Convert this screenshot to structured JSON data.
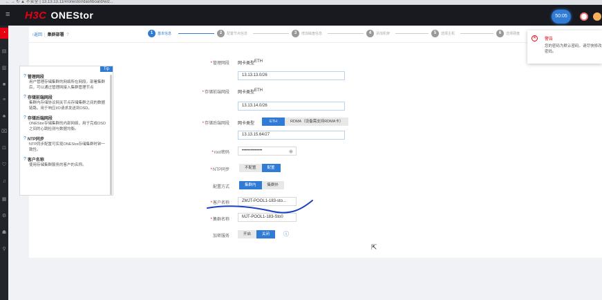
{
  "browser": {
    "url": "← → ↻  ▲ 不安全 | 13.13.13.11/#/onestor/dashboard/wiz..."
  },
  "app": {
    "brand_h3c": "H3C",
    "brand_name": "ONEStor",
    "timer": "50:05"
  },
  "breadcrumb": {
    "back": "↑返回",
    "current": "集群部署",
    "help": "?"
  },
  "steps": [
    {
      "num": "1",
      "label": "基本信息"
    },
    {
      "num": "2",
      "label": "配置节点信息"
    },
    {
      "num": "3",
      "label": "增加磁盘信息"
    },
    {
      "num": "4",
      "label": "添加机架"
    },
    {
      "num": "5",
      "label": "选择主机"
    },
    {
      "num": "6",
      "label": "选择硬盘"
    }
  ],
  "tip": {
    "badge": "Tip",
    "items": [
      {
        "title": "管理网段",
        "desc": "用户管理存储集群的网络所在网段。部署集群后，可以通过管理网接入集群管理节点"
      },
      {
        "title": "存储前端网段",
        "desc": "集群内存储协议网关节点存储集群之间的数据链路，用于响应I/O请求发送到OSD。"
      },
      {
        "title": "存储后端网段",
        "desc": "ONEStor存储集群的内部网络，用于完成OSD之间的心跳检测与数据均衡。"
      },
      {
        "title": "NTP同步",
        "desc": "NTP同步配置可实现ONEStor存储集群时钟一致性。"
      },
      {
        "title": "客户名称",
        "desc": "使用存储集群服务的客户的名称。"
      }
    ]
  },
  "form": {
    "mgmt": {
      "label": "管理网段",
      "nic_label": "网卡类型",
      "nic_value": "ETH",
      "ip": "13.13.13.0/26"
    },
    "front": {
      "label": "存储前端网段",
      "nic_label": "网卡类型",
      "nic_value": "ETH",
      "ip": "13.13.14.0/26"
    },
    "back": {
      "label": "存储后端网段",
      "nic_label": "网卡类型",
      "opt_eth": "ETH",
      "opt_rdma": "RDMA（设备需支持RDMA卡）",
      "ip": "13.13.15.64/27"
    },
    "root": {
      "label": "root密码",
      "value": "••••••••••••••",
      "eye": "◉"
    },
    "ntp": {
      "label": "NTP同步",
      "off": "不配置",
      "on": "配置"
    },
    "mode": {
      "label": "配置方式",
      "inner": "集群内",
      "outer": "集群外"
    },
    "customer": {
      "label": "客户名称",
      "value": "ZMJT-POOL1-183-sto..."
    },
    "cluster": {
      "label": "集群名称",
      "value": "MJT-POOL1-183-Sto0"
    },
    "encrypt": {
      "label": "加密服务",
      "on": "开启",
      "off": "关闭",
      "info": "ⓘ"
    }
  },
  "toast": {
    "icon": "✕",
    "title": "警告",
    "message": "您的密码为默认密码，请尽快修改密码。"
  },
  "colors": {
    "accent": "#2f7bd6",
    "brand_red": "#e60012",
    "topbar": "#181a1f",
    "ink": "#1a3fc2"
  }
}
